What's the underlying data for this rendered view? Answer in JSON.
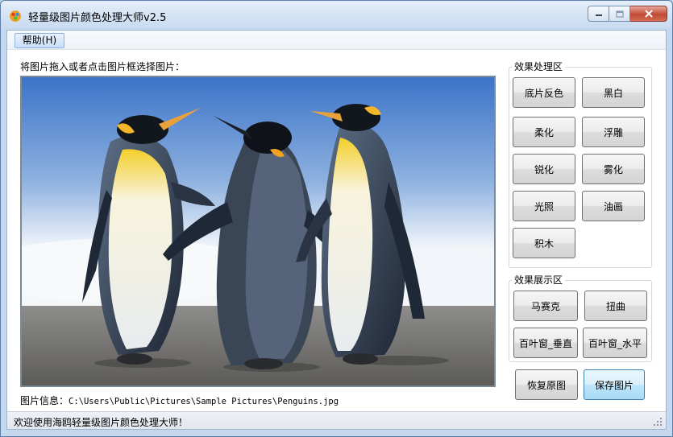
{
  "window": {
    "title": "轻量级图片颜色处理大师v2.5"
  },
  "menu": {
    "help_label": "帮助(H)"
  },
  "main": {
    "hint": "将图片拖入或者点击图片框选择图片：",
    "image_alt": "Penguins",
    "info_label": "图片信息：",
    "info_path": "C:\\Users\\Public\\Pictures\\Sample Pictures\\Penguins.jpg"
  },
  "effects_group": {
    "label": "效果处理区",
    "buttons": [
      "底片反色",
      "黑白",
      "柔化",
      "浮雕",
      "锐化",
      "雾化",
      "光照",
      "油画",
      "积木"
    ]
  },
  "display_group": {
    "label": "效果展示区",
    "buttons": [
      "马赛克",
      "扭曲",
      "百叶窗_垂直",
      "百叶窗_水平"
    ]
  },
  "actions": {
    "restore_label": "恢复原图",
    "save_label": "保存图片"
  },
  "status": {
    "text": "欢迎使用海鸥轻量级图片颜色处理大师！"
  },
  "colors": {
    "accent": "#3c7fb1",
    "close_button": "#c24a33"
  }
}
